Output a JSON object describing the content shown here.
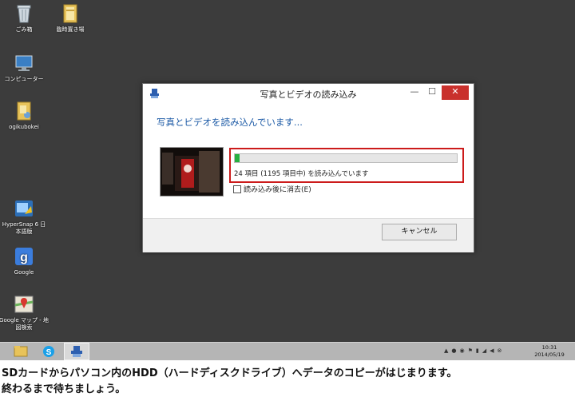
{
  "desktop": {
    "icons": [
      {
        "label": "ごみ箱",
        "icon": "recycle-bin-icon"
      },
      {
        "label": "臨時置き場",
        "icon": "folder-icon"
      },
      {
        "label": "コンピューター",
        "icon": "computer-icon"
      },
      {
        "label": "ogikubokei",
        "icon": "user-folder-icon"
      },
      {
        "label": "HyperSnap 6 日\n本語版",
        "icon": "hypersnap-icon"
      },
      {
        "label": "Google",
        "icon": "google-icon"
      },
      {
        "label": "Google マップ - 地\n図検索",
        "icon": "google-maps-icon"
      }
    ]
  },
  "dialog": {
    "title": "写真とビデオの読み込み",
    "minimize": "—",
    "maximize": "☐",
    "close": "✕",
    "heading": "写真とビデオを読み込んでいます...",
    "progress_text": "24 項目 (1195 項目中) を読み込んでいます",
    "progress_fraction": 0.02,
    "delete_after_import": "読み込み後に消去(E)",
    "delete_checked": false,
    "cancel": "キャンセル"
  },
  "taskbar": {
    "apps": [
      "file-explorer-icon",
      "skype-icon",
      "photo-import-icon"
    ],
    "clock_time": "10:31",
    "clock_date": "2014/05/19"
  },
  "caption": {
    "line1": "SDカードからパソコン内のHDD（ハードディスクドライブ）へデータのコピーがはじまります。",
    "line2": "終わるまで待ちましょう。"
  },
  "colors": {
    "desktop_bg": "#3c3c3c",
    "accent_text": "#1c5aa6",
    "highlight_border": "#cc1b1b",
    "progress_fill": "#26b040",
    "close_button": "#c9302c"
  }
}
